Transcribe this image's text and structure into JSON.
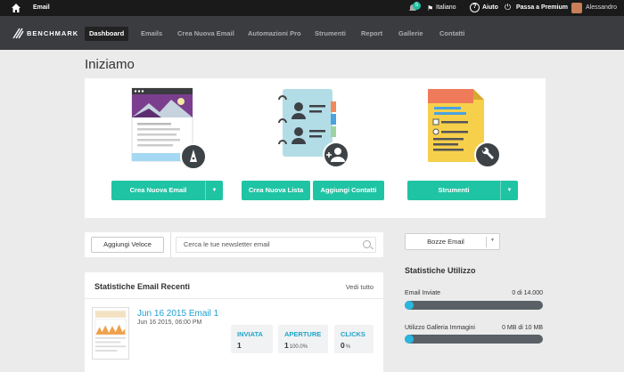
{
  "topbar": {
    "section": "Email",
    "notifications": "5",
    "language": "Italiano",
    "help": "Aiuto",
    "premium": "Passa a Premium",
    "user": "Alessandro"
  },
  "nav": {
    "logo": "BENCHMARK",
    "items": [
      "Dashboard",
      "Emails",
      "Crea Nuova Email",
      "Automazioni Pro",
      "Strumenti",
      "Report",
      "Gallerie",
      "Contatti"
    ]
  },
  "page": {
    "title": "Iniziamo"
  },
  "start": {
    "create_email": "Crea Nuova Email",
    "create_list": "Crea Nuova Lista",
    "add_contacts": "Aggiungi Contatti",
    "tools": "Strumenti"
  },
  "search": {
    "quick_add": "Aggiungi Veloce",
    "placeholder": "Cerca le tue newsletter email"
  },
  "recent_stats": {
    "title": "Statistiche Email Recenti",
    "view_all": "Vedi tutto",
    "email_title": "Jun 16 2015 Email 1",
    "email_date": "Jun 16 2015, 06:00 PM",
    "metrics": [
      {
        "label": "INVIATA",
        "value": "1",
        "sub": ""
      },
      {
        "label": "APERTURE",
        "value": "1",
        "sub": "100.0%"
      },
      {
        "label": "CLICKS",
        "value": "0",
        "sub": "%"
      }
    ]
  },
  "drafts": {
    "label": "Bozze Email"
  },
  "usage": {
    "title": "Statistiche Utilizzo",
    "rows": [
      {
        "label": "Email Inviate",
        "value": "0 di 14.000",
        "fraction": 0.0
      },
      {
        "label": "Utilizzo Galleria Immagini",
        "value": "0 MB di 10 MB",
        "fraction": 0.0
      }
    ]
  },
  "colors": {
    "accent": "#1fc4a4",
    "nav_bg": "#3a3c3f",
    "link": "#1f9fd4"
  }
}
